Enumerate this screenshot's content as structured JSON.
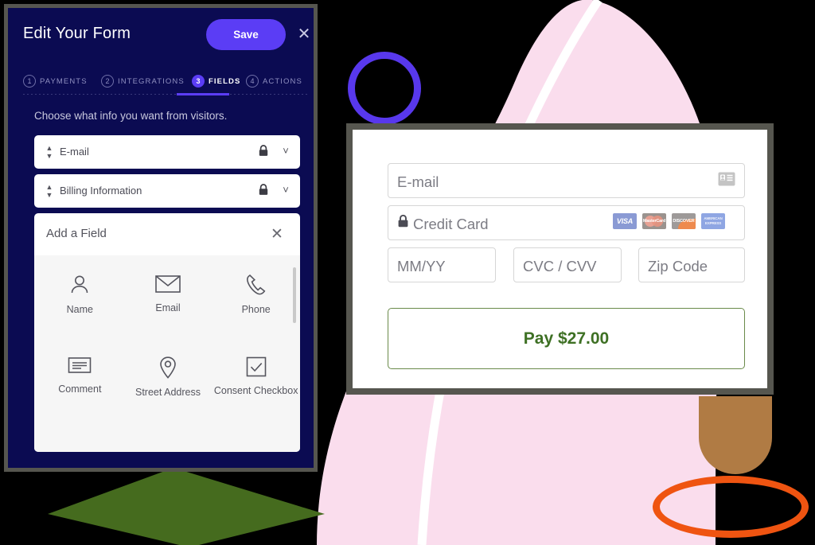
{
  "editor": {
    "title": "Edit Your Form",
    "save_label": "Save",
    "close_icon": "close-icon",
    "subtitle": "Choose what info you want from visitors.",
    "steps": [
      {
        "num": "1",
        "label": "PAYMENTS",
        "active": false
      },
      {
        "num": "2",
        "label": "INTEGRATIONS",
        "active": false
      },
      {
        "num": "3",
        "label": "FIELDS",
        "active": true
      },
      {
        "num": "4",
        "label": "ACTIONS",
        "active": false
      }
    ],
    "fields": [
      {
        "name": "E-mail",
        "lock_icon": "lock-icon",
        "chevron_icon": "chevron-down-icon",
        "sorter_icon": "sort-handle-icon"
      },
      {
        "name": "Billing Information",
        "lock_icon": "lock-icon",
        "chevron_icon": "chevron-down-icon",
        "sorter_icon": "sort-handle-icon"
      }
    ],
    "add_field": {
      "title": "Add a Field",
      "close_icon": "close-icon",
      "tiles": [
        {
          "label": "Name",
          "icon": "person-icon"
        },
        {
          "label": "Email",
          "icon": "envelope-icon"
        },
        {
          "label": "Phone",
          "icon": "phone-icon"
        },
        {
          "label": "Comment",
          "icon": "comment-lines-icon"
        },
        {
          "label": "Street\nAddress",
          "icon": "map-pin-icon"
        },
        {
          "label": "Consent\nCheckbox",
          "icon": "checkbox-checked-icon"
        }
      ]
    }
  },
  "checkout": {
    "email_placeholder": "E-mail",
    "contact_icon": "contact-card-icon",
    "card_placeholder": "Credit Card",
    "card_lock_icon": "lock-icon",
    "card_brands": [
      {
        "name": "visa",
        "text": "VISA"
      },
      {
        "name": "mastercard",
        "text": "MasterCard"
      },
      {
        "name": "discover",
        "text": "DISCOVER"
      },
      {
        "name": "amex",
        "text": "AMERICAN EXPRESS"
      }
    ],
    "expiry_placeholder": "MM/YY",
    "cvc_placeholder": "CVC / CVV",
    "zip_placeholder": "Zip Code",
    "pay_label": "Pay $27.00"
  },
  "colors": {
    "panel_navy": "#0b0b52",
    "accent_purple": "#5b3df5",
    "pay_green": "#3e7024",
    "frame_gray": "#56564f",
    "blob_pink": "#fadded",
    "ring_orange": "#ef5411",
    "shape_brown": "#b07b44",
    "diamond_green": "#456b1e",
    "background": "#000000"
  },
  "decorations": [
    {
      "name": "pink-blob",
      "color": "#fadded"
    },
    {
      "name": "white-curve-stripe",
      "color": "#ffffff"
    },
    {
      "name": "purple-ring",
      "color": "#5838ec"
    },
    {
      "name": "orange-ellipse",
      "color": "#ef5411"
    },
    {
      "name": "brown-rounded-shape",
      "color": "#b07b44"
    },
    {
      "name": "green-diamond",
      "color": "#456b1e"
    }
  ]
}
